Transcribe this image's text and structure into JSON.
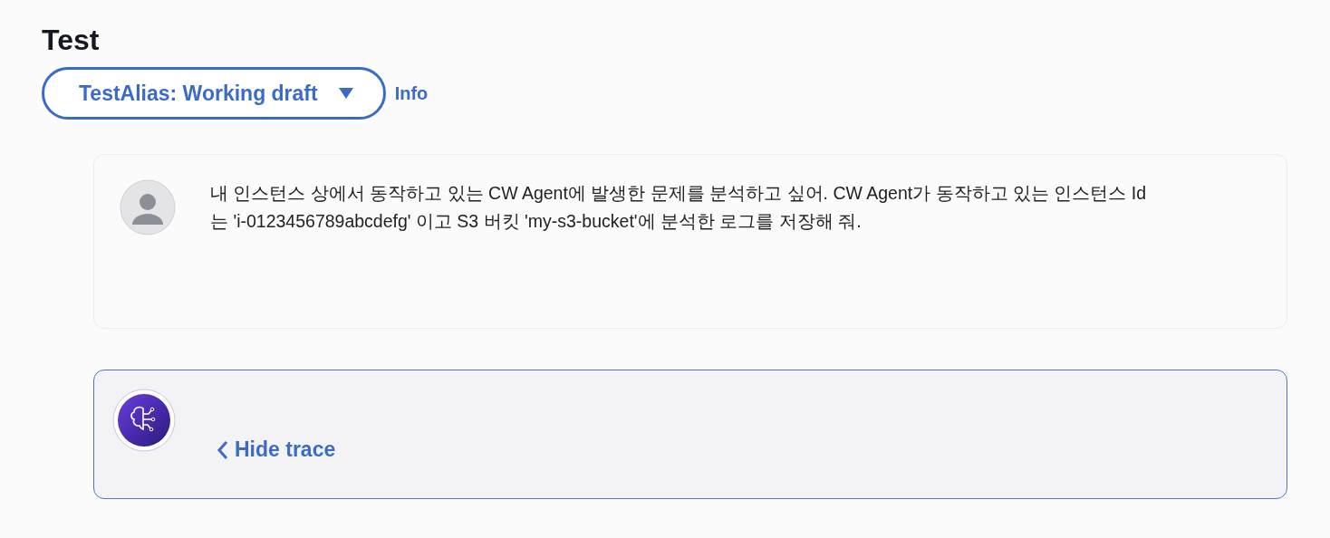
{
  "title": "Test",
  "alias_selector": {
    "label": "TestAlias: Working draft"
  },
  "info_link": "Info",
  "messages": [
    {
      "kind": "user",
      "text": "내 인스턴스 상에서 동작하고 있는 CW Agent에 발생한 문제를 분석하고 싶어. CW Agent가 동작하고 있는 인스턴스 Id는 'i-0123456789abcdefg' 이고 S3 버킷 'my-s3-bucket'에 분석한 로그를 저장해 줘."
    },
    {
      "kind": "agent",
      "trace_toggle": "Hide trace",
      "trace_expanded": true
    }
  ]
}
